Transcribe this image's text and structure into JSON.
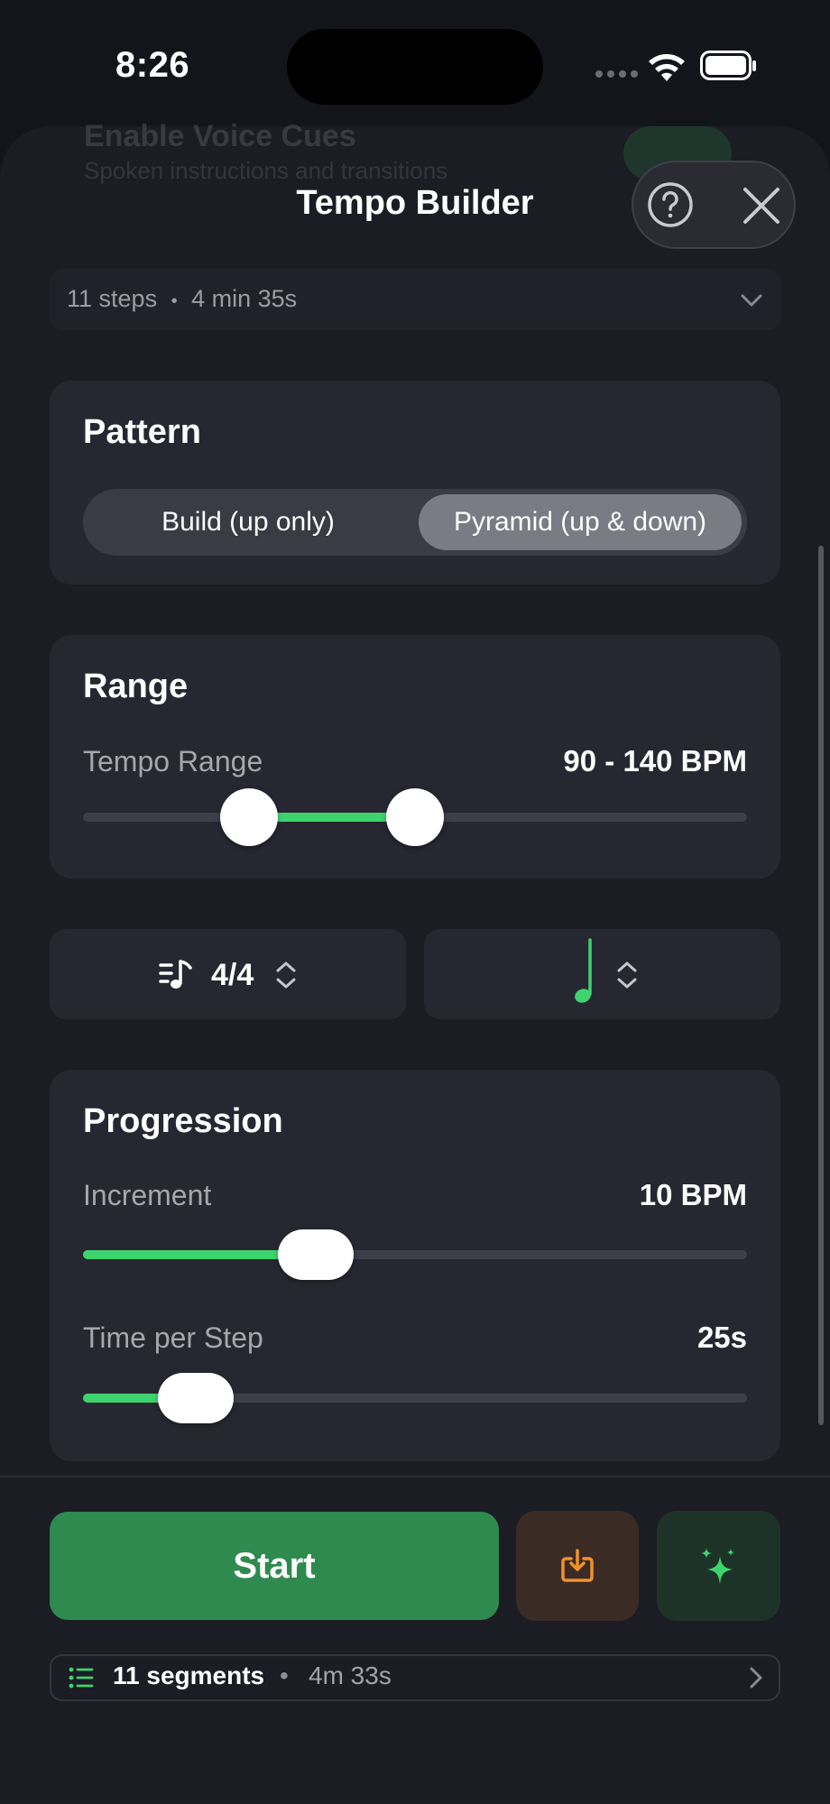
{
  "status": {
    "time": "8:26"
  },
  "background_hint": {
    "title": "Enable Voice Cues",
    "subtitle": "Spoken instructions and transitions"
  },
  "header": {
    "title": "Tempo Builder",
    "help_icon": "question-circle-icon",
    "close_icon": "close-x-icon"
  },
  "summary": {
    "steps": "11 steps",
    "separator": "•",
    "duration": "4 min 35s"
  },
  "pattern": {
    "title": "Pattern",
    "options": [
      "Build (up only)",
      "Pyramid (up & down)"
    ],
    "selected": "Pyramid (up & down)"
  },
  "range": {
    "title": "Range",
    "label": "Tempo Range",
    "value": "90 - 140 BPM",
    "low_fraction": 0.25,
    "high_fraction": 0.5
  },
  "time_signature": {
    "value": "4/4",
    "icon": "music-note-list-icon"
  },
  "note_value": {
    "icon": "quarter-note-icon"
  },
  "progression": {
    "title": "Progression",
    "increment_label": "Increment",
    "increment_value": "10 BPM",
    "increment_fraction": 0.35,
    "time_label": "Time per Step",
    "time_value": "25s",
    "time_fraction": 0.17
  },
  "actions": {
    "start_label": "Start",
    "import_icon": "tray-arrow-down-icon",
    "sparkle_icon": "sparkles-icon"
  },
  "segments": {
    "count": "11 segments",
    "separator": "•",
    "duration": "4m 33s"
  },
  "colors": {
    "accent_green": "#3ed46d",
    "start_green": "#2e8a4e",
    "import_orange": "#f0912c",
    "sheet_bg": "#1b1c24",
    "card_bg": "#262730"
  }
}
